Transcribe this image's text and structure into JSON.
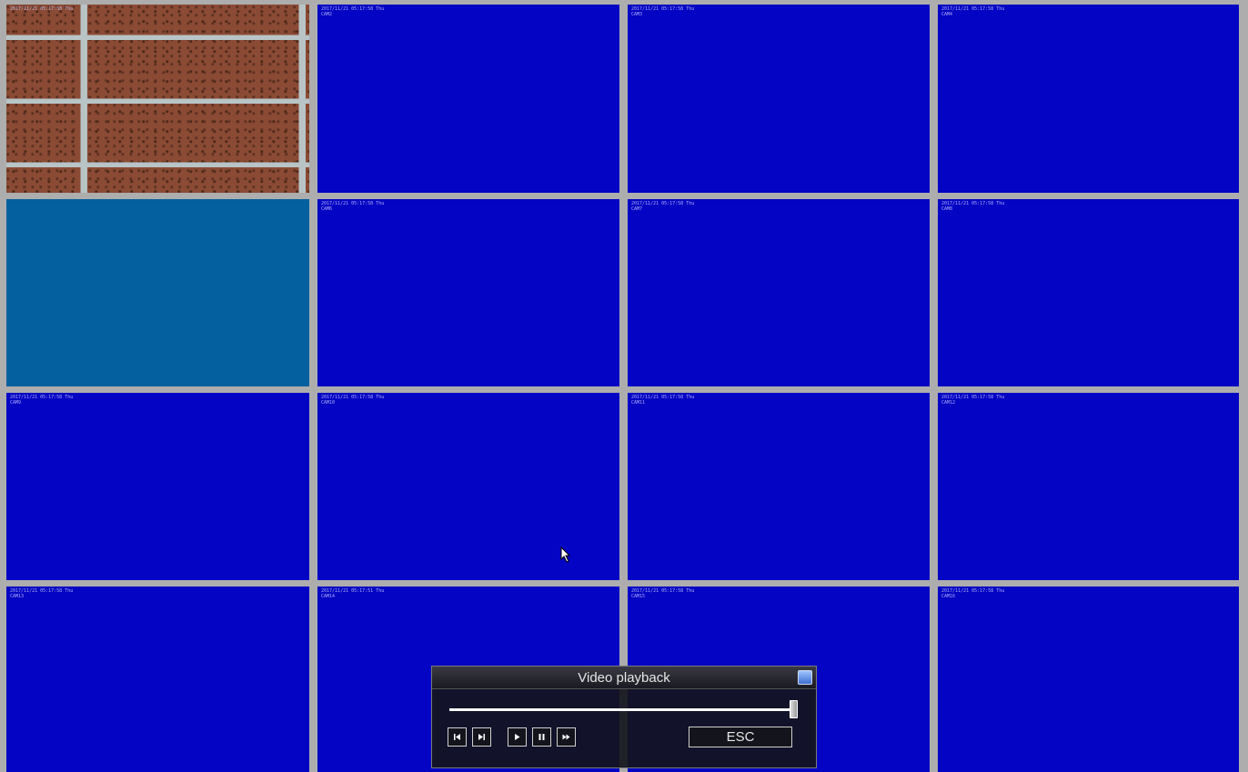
{
  "cameras": [
    {
      "id": "cam-1",
      "feed": "brick",
      "osd_line1": "2017/11/21 05:17:58 Thu",
      "osd_line2": ""
    },
    {
      "id": "cam-2",
      "feed": "blue",
      "osd_line1": "2017/11/21 05:17:58 Thu",
      "osd_line2": "CAM2"
    },
    {
      "id": "cam-3",
      "feed": "blue",
      "osd_line1": "2017/11/21 05:17:58 Thu",
      "osd_line2": "CAM3"
    },
    {
      "id": "cam-4",
      "feed": "blue",
      "osd_line1": "2017/11/21 05:17:58 Thu",
      "osd_line2": "CAM4"
    },
    {
      "id": "cam-5",
      "feed": "teal",
      "osd_line1": "",
      "osd_line2": ""
    },
    {
      "id": "cam-6",
      "feed": "blue",
      "osd_line1": "2017/11/21 05:17:58 Thu",
      "osd_line2": "CAM6"
    },
    {
      "id": "cam-7",
      "feed": "blue",
      "osd_line1": "2017/11/21 05:17:58 Thu",
      "osd_line2": "CAM7"
    },
    {
      "id": "cam-8",
      "feed": "blue",
      "osd_line1": "2017/11/21 05:17:58 Thu",
      "osd_line2": "CAM8"
    },
    {
      "id": "cam-9",
      "feed": "blue",
      "osd_line1": "2017/11/21 05:17:58 Thu",
      "osd_line2": "CAM9"
    },
    {
      "id": "cam-10",
      "feed": "blue",
      "osd_line1": "2017/11/21 05:17:58 Thu",
      "osd_line2": "CAM10"
    },
    {
      "id": "cam-11",
      "feed": "blue",
      "osd_line1": "2017/11/21 05:17:58 Thu",
      "osd_line2": "CAM11"
    },
    {
      "id": "cam-12",
      "feed": "blue",
      "osd_line1": "2017/11/21 05:17:58 Thu",
      "osd_line2": "CAM12"
    },
    {
      "id": "cam-13",
      "feed": "blue",
      "osd_line1": "2017/11/21 05:17:58 Thu",
      "osd_line2": "CAM13"
    },
    {
      "id": "cam-14",
      "feed": "blue",
      "osd_line1": "2017/11/21 05:17:51 Thu",
      "osd_line2": "CAM14"
    },
    {
      "id": "cam-15",
      "feed": "blue",
      "osd_line1": "2017/11/21 05:17:58 Thu",
      "osd_line2": "CAM15"
    },
    {
      "id": "cam-16",
      "feed": "blue",
      "osd_line1": "2017/11/21 05:17:58 Thu",
      "osd_line2": "CAM16"
    }
  ],
  "colors": {
    "grid_line": "#adadad",
    "empty_feed": "#0404c4",
    "teal_feed": "#04609e"
  },
  "playback": {
    "title": "Video playback",
    "progress": 1.0,
    "controls": [
      {
        "name": "prev-frame-icon",
        "label": "previous"
      },
      {
        "name": "next-frame-icon",
        "label": "next"
      },
      {
        "name": "play-icon",
        "label": "play"
      },
      {
        "name": "pause-icon",
        "label": "pause"
      },
      {
        "name": "fast-forward-icon",
        "label": "fast forward"
      }
    ],
    "esc_label": "ESC"
  }
}
